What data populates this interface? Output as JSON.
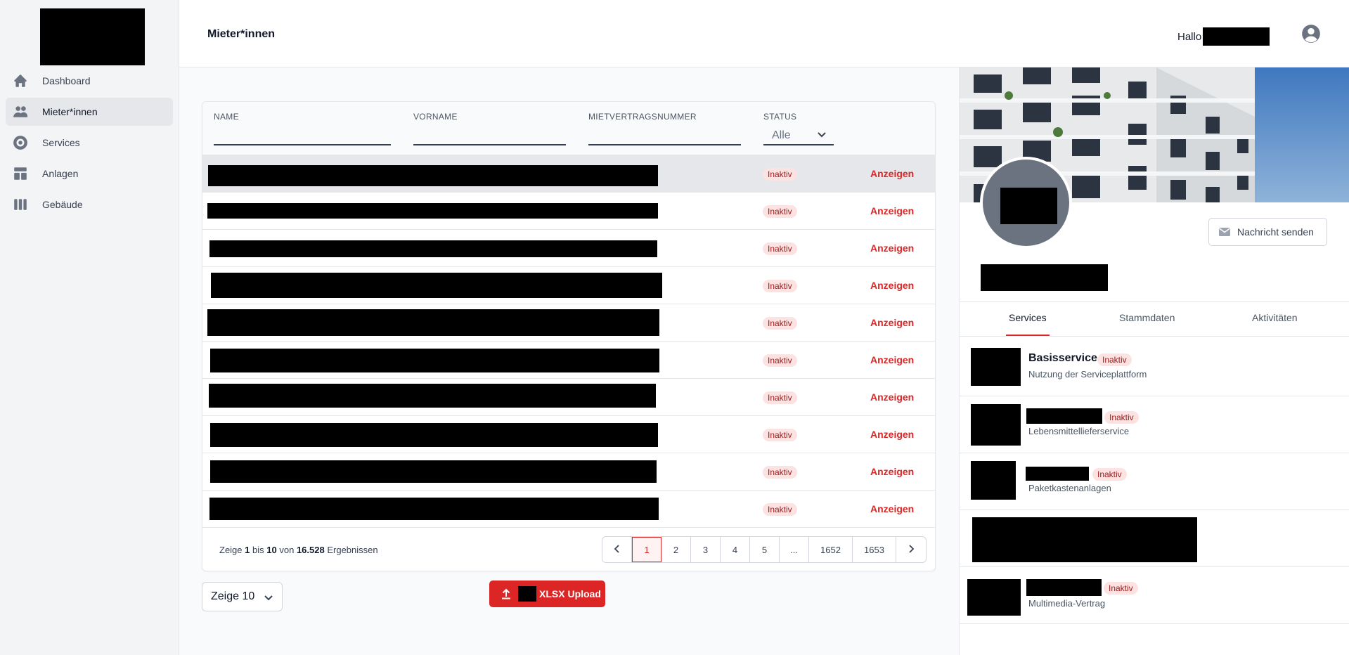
{
  "sidebar": {
    "items": [
      {
        "label": "Dashboard",
        "icon": "home-icon"
      },
      {
        "label": "Mieter*innen",
        "icon": "users-icon"
      },
      {
        "label": "Services",
        "icon": "lifebuoy-icon"
      },
      {
        "label": "Anlagen",
        "icon": "template-icon"
      },
      {
        "label": "Gebäude",
        "icon": "columns-icon"
      }
    ]
  },
  "header": {
    "title": "Mieter*innen",
    "greeting": "Hallo"
  },
  "table": {
    "filters": {
      "name": "NAME",
      "vorname": "VORNAME",
      "mietvertragsnummer": "MIETVERTRAGSNUMMER",
      "status": "STATUS",
      "status_value": "Alle"
    },
    "rows": [
      {
        "status": "Inaktiv",
        "action": "Anzeigen"
      },
      {
        "status": "Inaktiv",
        "action": "Anzeigen"
      },
      {
        "status": "Inaktiv",
        "action": "Anzeigen"
      },
      {
        "status": "Inaktiv",
        "action": "Anzeigen"
      },
      {
        "status": "Inaktiv",
        "action": "Anzeigen"
      },
      {
        "status": "Inaktiv",
        "action": "Anzeigen"
      },
      {
        "status": "Inaktiv",
        "action": "Anzeigen"
      },
      {
        "status": "Inaktiv",
        "action": "Anzeigen"
      },
      {
        "status": "Inaktiv",
        "action": "Anzeigen"
      },
      {
        "status": "Inaktiv",
        "action": "Anzeigen"
      }
    ],
    "result": {
      "prefix": "Zeige",
      "from": "1",
      "to_word": "bis",
      "to": "10",
      "of_word": "von",
      "total": "16.528",
      "suffix": "Ergebnissen"
    },
    "pagination": [
      "1",
      "2",
      "3",
      "4",
      "5",
      "...",
      "1652",
      "1653"
    ],
    "active_page": "1"
  },
  "per_page": "Zeige 10",
  "upload_label": "XLSX Upload",
  "panel": {
    "message_button": "Nachricht senden",
    "tabs": [
      "Services",
      "Stammdaten",
      "Aktivitäten"
    ],
    "services": [
      {
        "title": "Basisservice",
        "badge": "Inaktiv",
        "subtitle": "Nutzung der Serviceplattform"
      },
      {
        "title": "",
        "badge": "Inaktiv",
        "subtitle": "Lebensmittellieferservice"
      },
      {
        "title": "",
        "badge": "Inaktiv",
        "subtitle": "Paketkastenanlagen"
      },
      {
        "title": "",
        "badge": "",
        "subtitle": ""
      },
      {
        "title": "",
        "badge": "Inaktiv",
        "subtitle": "Multimedia-Vertrag"
      }
    ]
  },
  "colors": {
    "accent": "#dc2626",
    "badge_bg": "#fde2e2",
    "badge_text": "#991b1b"
  }
}
